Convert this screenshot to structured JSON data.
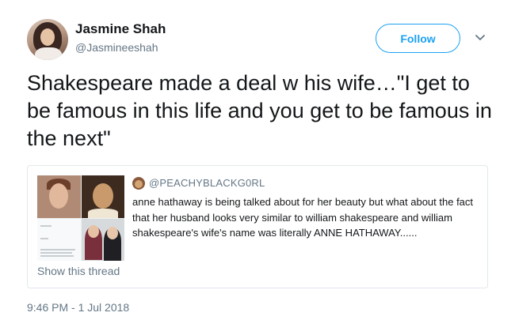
{
  "author": {
    "name": "Jasmine Shah",
    "handle": "@Jasmineeshah"
  },
  "follow_label": "Follow",
  "tweet_text": "Shakespeare made a deal w his wife…\"I get to be famous in this life and you get to be famous in the next\"",
  "quoted": {
    "handle": "@PEACHYBLACKG0RL",
    "text": "anne hathaway is being talked about for her beauty but what about the fact that her husband looks very similar to william shakespeare and william shakespeare's wife's name was literally ANNE HATHAWAY......",
    "show_thread": "Show this thread"
  },
  "timestamp": "9:46 PM - 1 Jul 2018",
  "colors": {
    "accent": "#1da1f2",
    "secondary_text": "#657786",
    "border": "#e1e8ed"
  }
}
